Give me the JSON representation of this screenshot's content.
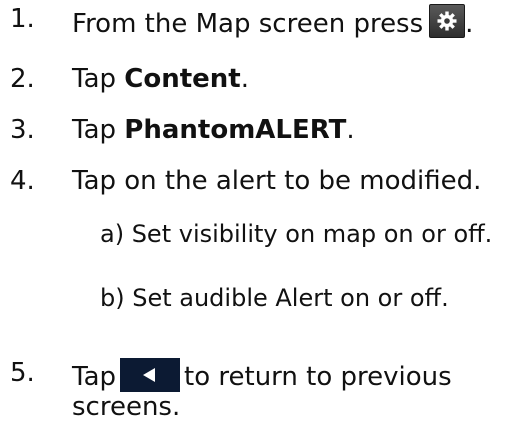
{
  "steps": [
    {
      "number": "1.",
      "text_before": "From the Map screen press",
      "icon": "gear-icon",
      "text_after": "."
    },
    {
      "number": "2.",
      "text_before": "Tap ",
      "bold": "Content",
      "text_after": "."
    },
    {
      "number": "3.",
      "text_before": "Tap ",
      "bold": "PhantomALERT",
      "text_after": "."
    },
    {
      "number": "4.",
      "text": "Tap on the alert to be modified."
    },
    {
      "number": "5.",
      "text_before": "Tap",
      "icon": "back-arrow-icon",
      "text_after": "to return to previous",
      "text_line2": "screens."
    }
  ],
  "substeps": [
    "a) Set visibility on map on or off.",
    "b) Set audible Alert on or off."
  ],
  "colors": {
    "text": "#111111",
    "gear_button": "#3a3a3a",
    "back_button": "#0c1a33",
    "icon_fill": "#ffffff"
  }
}
